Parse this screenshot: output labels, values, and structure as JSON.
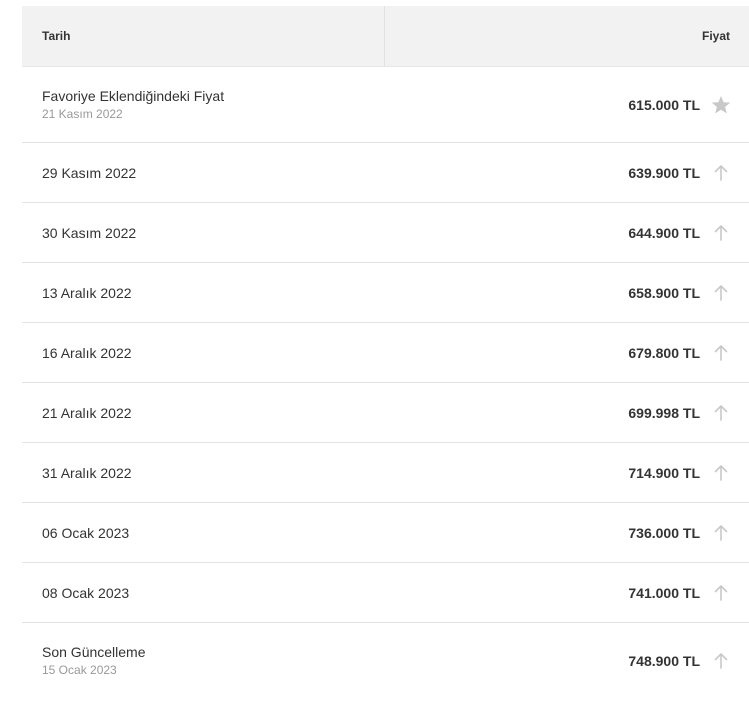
{
  "header": {
    "date_col": "Tarih",
    "price_col": "Fiyat"
  },
  "rows": [
    {
      "label": "Favoriye Eklendiğindeki Fiyat",
      "sub": "21 Kasım 2022",
      "price": "615.000 TL",
      "icon": "star-icon"
    },
    {
      "label": "29 Kasım 2022",
      "price": "639.900 TL",
      "icon": "arrow-up-icon"
    },
    {
      "label": "30 Kasım 2022",
      "price": "644.900 TL",
      "icon": "arrow-up-icon"
    },
    {
      "label": "13 Aralık 2022",
      "price": "658.900 TL",
      "icon": "arrow-up-icon"
    },
    {
      "label": "16 Aralık 2022",
      "price": "679.800 TL",
      "icon": "arrow-up-icon"
    },
    {
      "label": "21 Aralık 2022",
      "price": "699.998 TL",
      "icon": "arrow-up-icon"
    },
    {
      "label": "31 Aralık 2022",
      "price": "714.900 TL",
      "icon": "arrow-up-icon"
    },
    {
      "label": "06 Ocak 2023",
      "price": "736.000 TL",
      "icon": "arrow-up-icon"
    },
    {
      "label": "08 Ocak 2023",
      "price": "741.000 TL",
      "icon": "arrow-up-icon"
    },
    {
      "label": "Son Güncelleme",
      "sub": "15 Ocak 2023",
      "price": "748.900 TL",
      "icon": "arrow-up-icon"
    }
  ],
  "colors": {
    "header_bg": "#f2f2f2",
    "icon_gray": "#c8c8c8",
    "divider": "#e2e2e2"
  }
}
